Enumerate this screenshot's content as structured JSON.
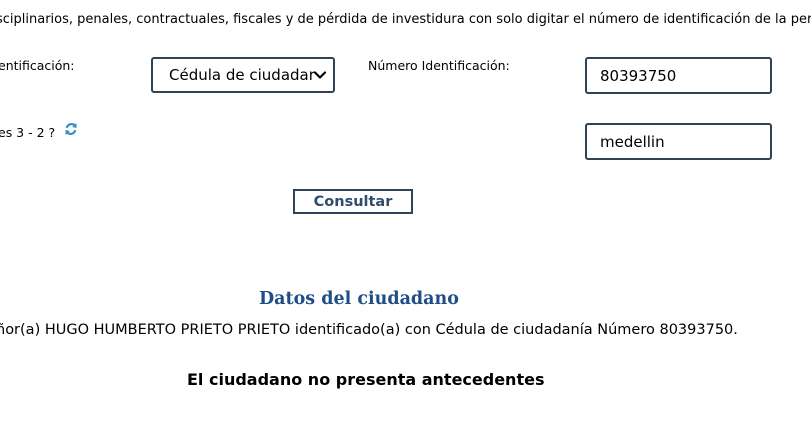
{
  "intro": {
    "text": "sciplinarios, penales, contractuales, fiscales y de pérdida de investidura con solo digitar el número de identificación de la person"
  },
  "form": {
    "tipo_label": "entificación:",
    "tipo_selected": "Cédula de ciudadar",
    "numero_label": "Número Identificación:",
    "numero_value": "80393750",
    "captcha_label": "es 3 - 2 ?",
    "captcha_answer": "medellin",
    "submit_label": "Consultar"
  },
  "result": {
    "title": "Datos del ciudadano",
    "line": "ñor(a)  HUGO HUMBERTO PRIETO PRIETO identificado(a) con Cédula de ciudadanía Número 80393750.",
    "status": "El ciudadano no presenta antecedentes"
  },
  "icons": {
    "refresh": "refresh-icon",
    "chevron": "chevron-down-icon"
  },
  "colors": {
    "border": "#2f4356",
    "title": "#1e4d87",
    "button_text": "#2f4e6b",
    "refresh": "#3a8fc4"
  }
}
